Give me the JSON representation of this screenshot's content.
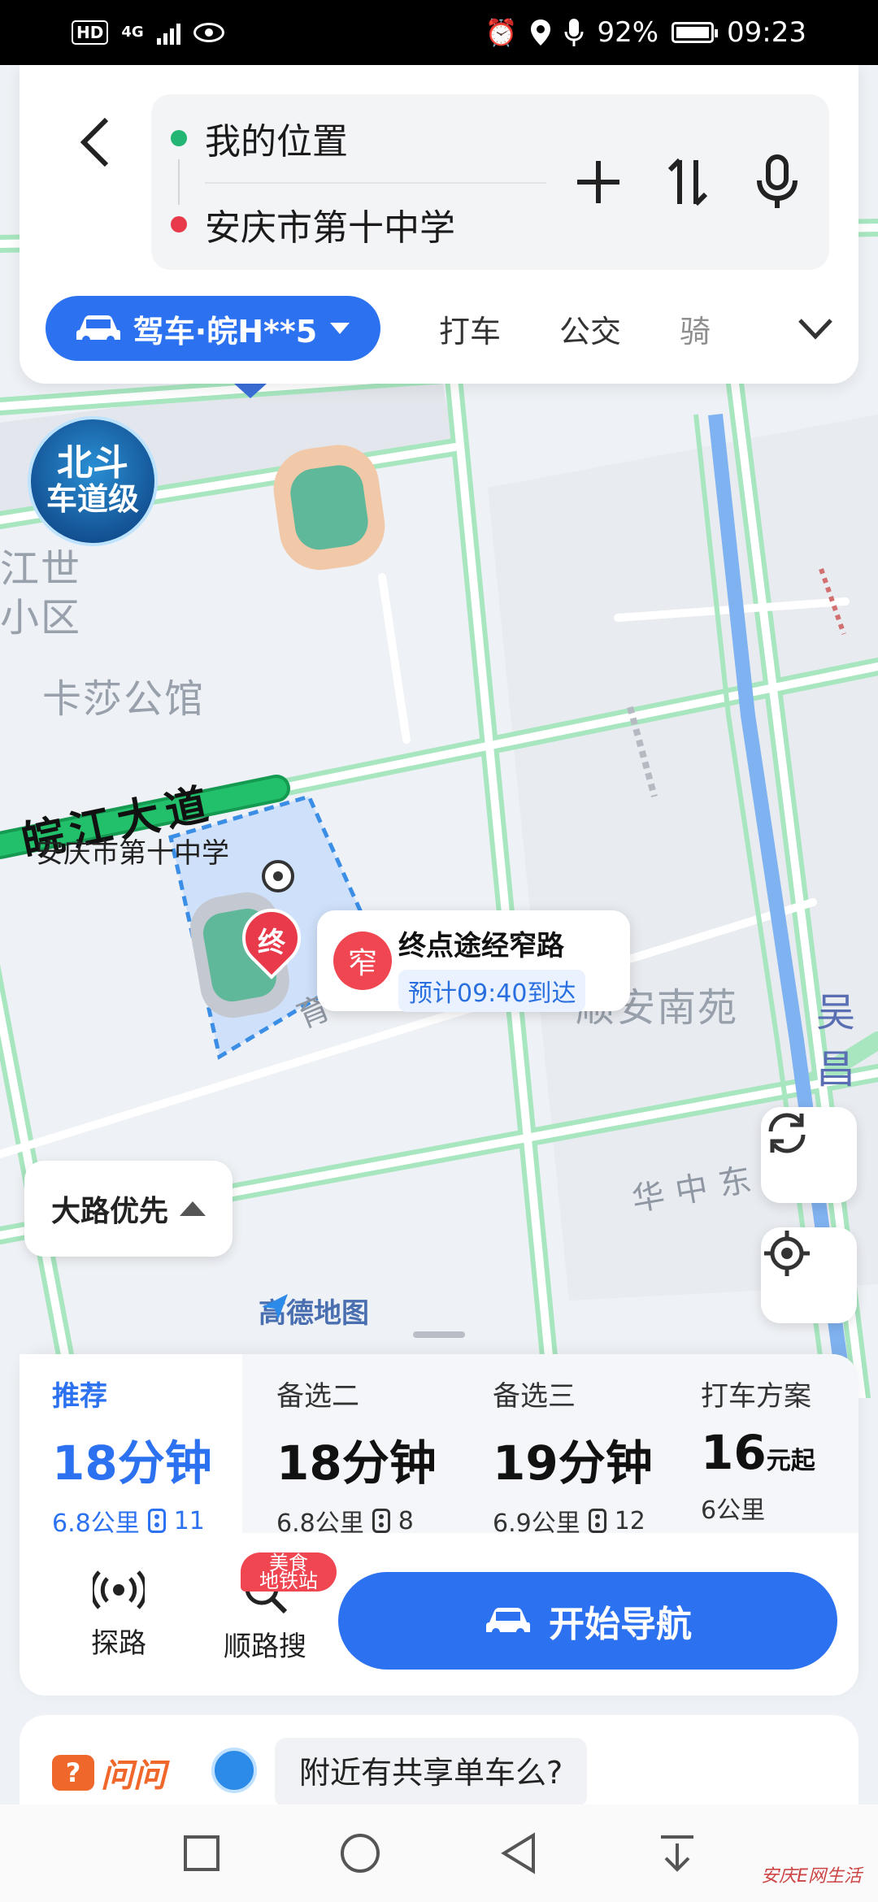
{
  "status_bar": {
    "hd": "HD",
    "network": "4G",
    "battery": "92%",
    "time": "09:23"
  },
  "search": {
    "origin": "我的位置",
    "destination": "安庆市第十中学",
    "origin_color": "#22b573",
    "destination_color": "#e83a4a"
  },
  "modes": {
    "active": "驾车·皖H**5",
    "tabs": [
      "打车",
      "公交",
      "骑"
    ]
  },
  "map": {
    "beidou_line1": "北斗",
    "beidou_line2": "车道级",
    "labels": {
      "community_1": "江世",
      "community_2": "小区",
      "kasha": "卡莎公馆",
      "shunan": "顺安南苑",
      "wuchang": "吴昌",
      "school": "安庆市第十中学"
    },
    "roads": {
      "wanjiang": "皖江大道",
      "yucai": "育才路",
      "huazhong": "华中东"
    },
    "dest_pin": "终",
    "callout": {
      "badge": "窄",
      "title": "终点途经窄路",
      "eta": "预计09:40到达"
    },
    "preference": "大路优先",
    "logo": "高德地图"
  },
  "routes": [
    {
      "head": "推荐",
      "time": "18分钟",
      "distance": "6.8公里",
      "lights": "11",
      "active": true
    },
    {
      "head": "备选二",
      "time": "18分钟",
      "distance": "6.8公里",
      "lights": "8",
      "active": false
    },
    {
      "head": "备选三",
      "time": "19分钟",
      "distance": "6.9公里",
      "lights": "12",
      "active": false
    },
    {
      "head": "打车方案",
      "price": "16",
      "price_unit": "元起",
      "distance": "6公里",
      "active": false
    }
  ],
  "tools": {
    "explore": "探路",
    "search_along": "顺路搜",
    "badge_line1": "美食",
    "badge_line2": "地铁站",
    "start_nav": "开始导航"
  },
  "ask": {
    "brand": "问问",
    "query": "附近有共享单车么?"
  },
  "watermark": "安庆E网生活",
  "colors": {
    "primary": "#2c72f0",
    "route_green": "#22c06a",
    "alert_red": "#ef4651",
    "ask_orange": "#f0672b"
  }
}
